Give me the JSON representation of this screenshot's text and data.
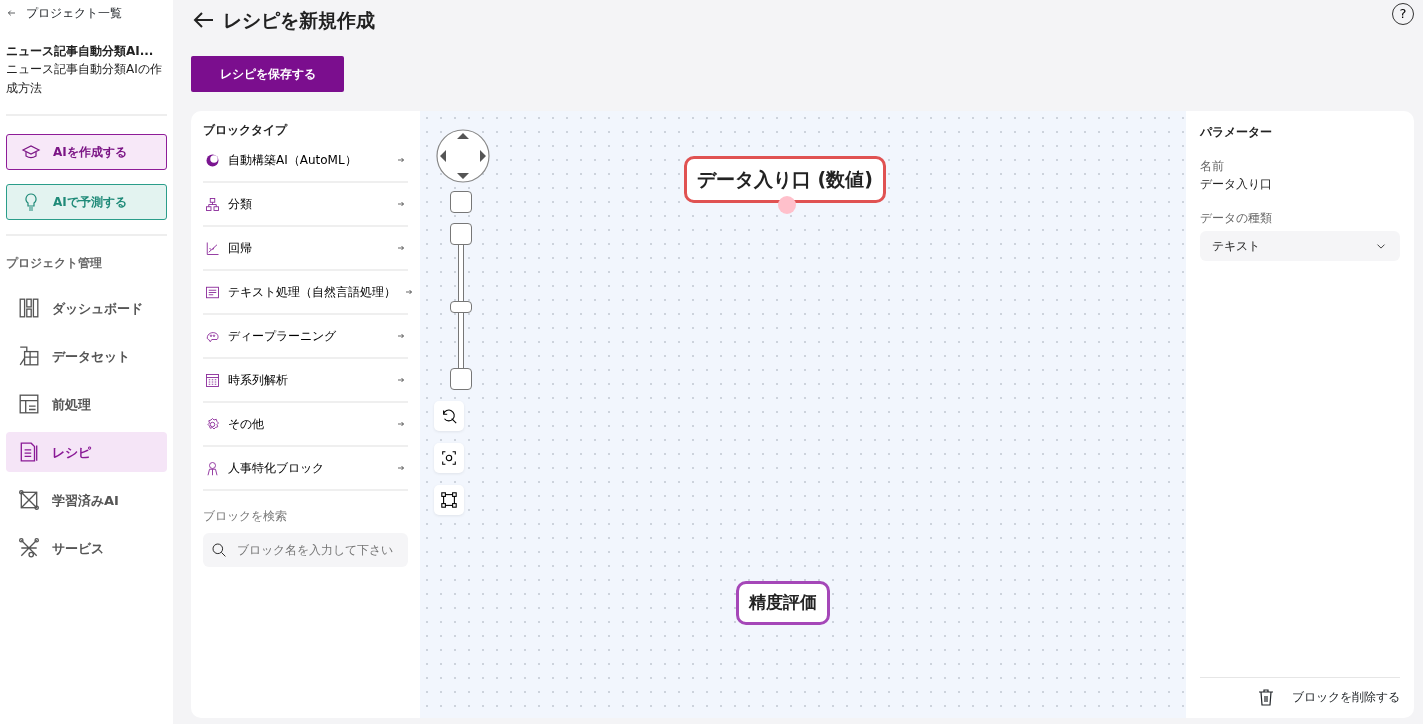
{
  "sidebar": {
    "back_link": "プロジェクト一覧",
    "project_title": "ニュース記事自動分類AI...",
    "project_subtitle": "ニュース記事自動分類AIの作成方法",
    "actions": [
      {
        "label": "AIを作成する",
        "kind": "create"
      },
      {
        "label": "AIで予測する",
        "kind": "predict"
      }
    ],
    "section_title": "プロジェクト管理",
    "items": [
      {
        "label": "ダッシュボード",
        "selected": false
      },
      {
        "label": "データセット",
        "selected": false
      },
      {
        "label": "前処理",
        "selected": false
      },
      {
        "label": "レシピ",
        "selected": true
      },
      {
        "label": "学習済みAI",
        "selected": false
      },
      {
        "label": "サービス",
        "selected": false
      }
    ]
  },
  "header": {
    "title": "レシピを新規作成",
    "help": "?"
  },
  "save_button": "レシピを保存する",
  "block_panel": {
    "title": "ブロックタイプ",
    "items": [
      {
        "label": "自動構築AI（AutoML）"
      },
      {
        "label": "分類"
      },
      {
        "label": "回帰"
      },
      {
        "label": "テキスト処理（自然言語処理）"
      },
      {
        "label": "ディープラーニング"
      },
      {
        "label": "時系列解析"
      },
      {
        "label": "その他"
      },
      {
        "label": "人事特化ブロック"
      }
    ],
    "search_label": "ブロックを検索",
    "search_placeholder": "ブロック名を入力して下さい"
  },
  "canvas": {
    "zoom_slider": {
      "level": 0.5
    },
    "nodes": [
      {
        "label": "データ入り口 (数値)",
        "color": "#e05252",
        "has_output_port": true
      },
      {
        "label": "精度評価",
        "color": "#a547b8",
        "has_output_port": false
      }
    ]
  },
  "parameters": {
    "title": "パラメーター",
    "name_label": "名前",
    "name_value": "データ入り口",
    "type_label": "データの種類",
    "type_value": "テキスト",
    "delete_button": "ブロックを削除する"
  }
}
